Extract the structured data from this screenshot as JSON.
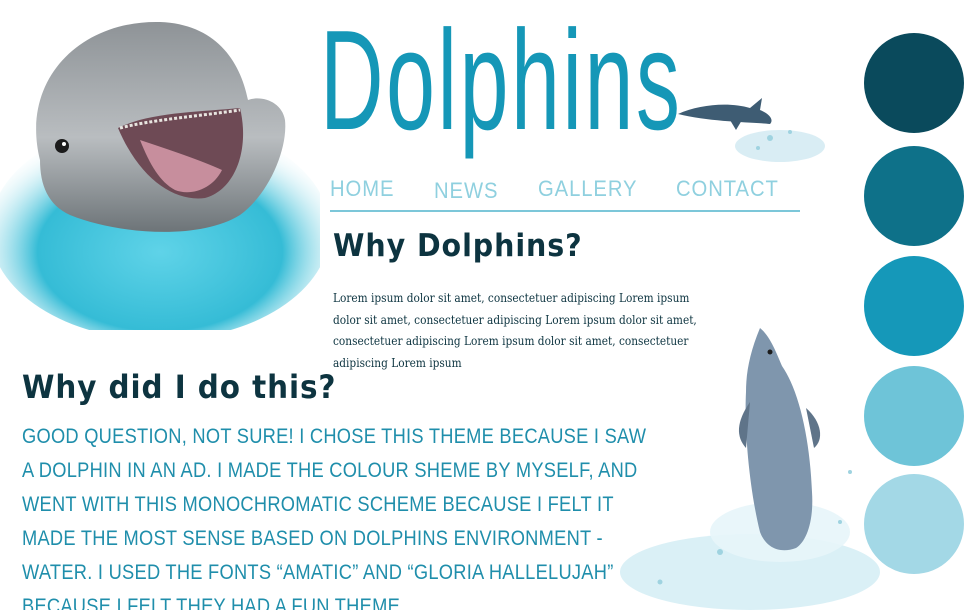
{
  "header": {
    "title": "Dolphins"
  },
  "nav": {
    "items": [
      "HomE",
      "NEWS",
      "GALLERY",
      "CONTACT"
    ]
  },
  "section_why": {
    "heading": "Why Dolphins?",
    "body": "Lorem ipsum dolor sit amet, consectetuer adipiscing Lorem ipsum dolor sit amet, consectetuer adipiscing Lorem ipsum dolor sit amet, consectetuer adipiscing Lorem ipsum dolor sit amet, consectetuer adipiscing Lorem ipsum"
  },
  "section_did": {
    "heading": "Why did I do this?",
    "body": "Good question, not sure! I chose this theme because I saw a dolphin in an ad. I made the colour sheme by myself, and went with this monochromatic scheme because I felt it made the most sense based on dolphins environment - water. I used the fonts “Amatic” and “Gloria Hallelujah” because I felt they had a fun theme."
  },
  "palette": {
    "colors": [
      "#0a4a5c",
      "#0e7189",
      "#1598b9",
      "#6ec4d8",
      "#a3d8e6"
    ]
  },
  "colors": {
    "title": "#1597b7",
    "nav": "#8fd0df",
    "heading": "#0d3440",
    "body_text": "#1f8eab"
  },
  "icons": {
    "hero": "dolphin-head-image",
    "leap": "leaping-dolphin-image",
    "jump": "jumping-dolphin-image"
  }
}
